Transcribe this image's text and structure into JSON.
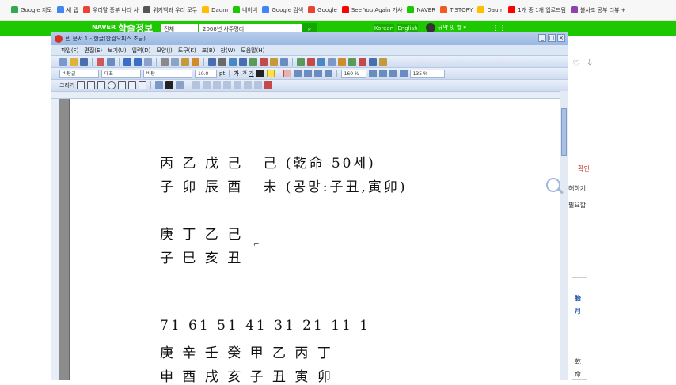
{
  "bookmarks": [
    {
      "label": "Google 지도",
      "color": "#34a853"
    },
    {
      "label": "새 탭",
      "color": "#4285f4"
    },
    {
      "label": "우리말 풍부 나라 사",
      "color": "#ea4335"
    },
    {
      "label": "위키백과 우리 모두",
      "color": "#555555"
    },
    {
      "label": "Daum",
      "color": "#ffbf00"
    },
    {
      "label": "네이버",
      "color": "#1ec800"
    },
    {
      "label": "Google 검색",
      "color": "#4285f4"
    },
    {
      "label": "Google",
      "color": "#ea4335"
    },
    {
      "label": "See You Again 가사",
      "color": "#ff0000"
    },
    {
      "label": "NAVER",
      "color": "#1ec800"
    },
    {
      "label": "TISTORY",
      "color": "#f15b22"
    },
    {
      "label": "Daum",
      "color": "#ffbf00"
    },
    {
      "label": "1개 중 1개 업로드됨",
      "color": "#ff0000"
    },
    {
      "label": "불사조 공부 리뷰 +",
      "color": "#8e44ad"
    }
  ],
  "naver": {
    "logo": "NAVER",
    "service": "학술정보",
    "select_value": "전체",
    "search_value": "2008년 사주명리",
    "lang_korean": "Korean",
    "lang_english": "English",
    "user_label": "규약 및 할 ▾",
    "apps_icon": "⋮⋮⋮"
  },
  "window": {
    "title": "빈 문서 1 - 한글(한컴오피스 조금)",
    "minimize": "_",
    "maximize": "□",
    "close": "×"
  },
  "menus": [
    "파일(F)",
    "편집(E)",
    "보기(U)",
    "입력(D)",
    "모양(J)",
    "도구(K)",
    "표(B)",
    "창(W)",
    "도움말(H)"
  ],
  "format": {
    "style": "바탕글",
    "lang": "대표",
    "font": "바탕",
    "size": "10.0",
    "size_unit": "pt",
    "line_spacing": "160 %",
    "zoom": "135 %",
    "bold": "가",
    "italic": "가",
    "underline": "가",
    "draw_label": "그리기"
  },
  "document": {
    "lines": [
      "丙 乙 戊 己   己 (乾命 50세)",
      "子 卯 辰 酉   未 (공망:子丑,寅卯)",
      "",
      "庚 丁 乙 己",
      "子 巳 亥 丑",
      "",
      "",
      "71 61 51 41 31 21 11 1",
      "庚 辛 壬 癸 甲 乙 丙 丁",
      "申 酉 戌 亥 子 丑 寅 卯"
    ]
  },
  "right_page": {
    "heart": "♡",
    "share": "⇩",
    "link_text": "확인",
    "more_text": "해하기",
    "note_text": "필요합",
    "hanja1": "胎",
    "hanja2": "月",
    "hanja3": "乾",
    "hanja4": "命"
  }
}
